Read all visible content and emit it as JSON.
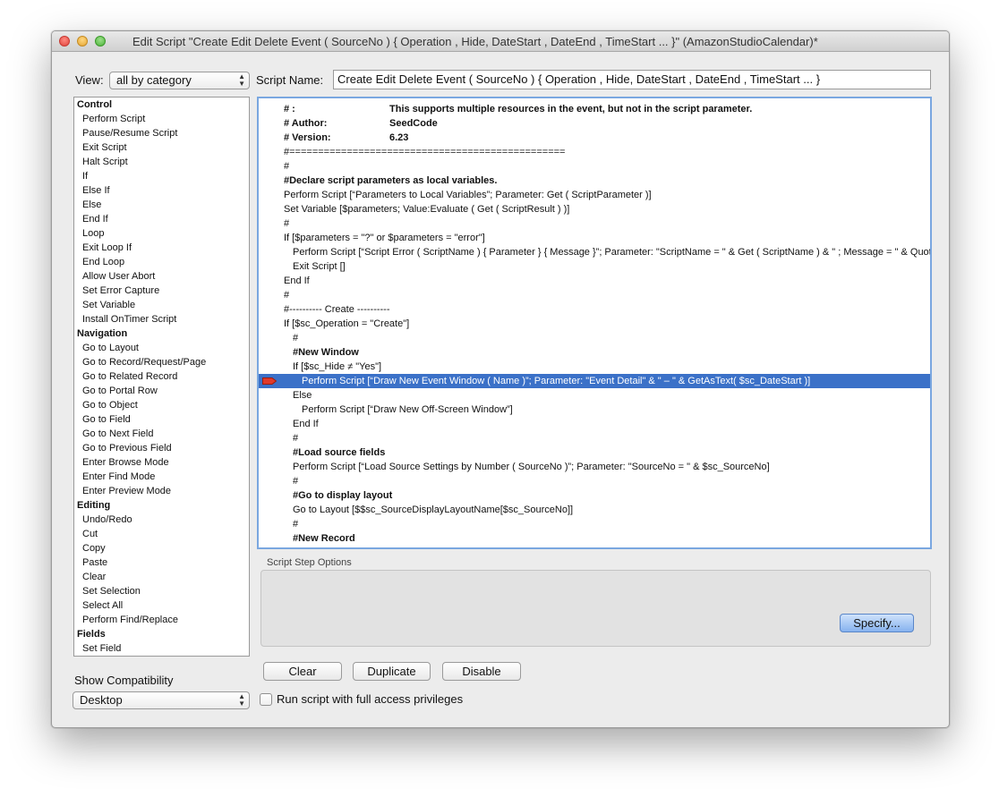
{
  "window": {
    "title": "Edit Script \"Create Edit Delete Event ( SourceNo ) { Operation , Hide, DateStart , DateEnd , TimeStart ... }\" (AmazonStudioCalendar)*"
  },
  "view": {
    "label": "View:",
    "value": "all by category"
  },
  "script_name": {
    "label": "Script Name:",
    "value": "Create Edit Delete Event ( SourceNo ) { Operation , Hide, DateStart , DateEnd , TimeStart ... }"
  },
  "steps": [
    {
      "type": "cat",
      "label": "Control"
    },
    {
      "type": "item",
      "label": "Perform Script"
    },
    {
      "type": "item",
      "label": "Pause/Resume Script"
    },
    {
      "type": "item",
      "label": "Exit Script"
    },
    {
      "type": "item",
      "label": "Halt Script"
    },
    {
      "type": "item",
      "label": "If"
    },
    {
      "type": "item",
      "label": "Else If"
    },
    {
      "type": "item",
      "label": "Else"
    },
    {
      "type": "item",
      "label": "End If"
    },
    {
      "type": "item",
      "label": "Loop"
    },
    {
      "type": "item",
      "label": "Exit Loop If"
    },
    {
      "type": "item",
      "label": "End Loop"
    },
    {
      "type": "item",
      "label": "Allow User Abort"
    },
    {
      "type": "item",
      "label": "Set Error Capture"
    },
    {
      "type": "item",
      "label": "Set Variable"
    },
    {
      "type": "item",
      "label": "Install OnTimer Script"
    },
    {
      "type": "cat",
      "label": "Navigation"
    },
    {
      "type": "item",
      "label": "Go to Layout"
    },
    {
      "type": "item",
      "label": "Go to Record/Request/Page"
    },
    {
      "type": "item",
      "label": "Go to Related Record"
    },
    {
      "type": "item",
      "label": "Go to Portal Row"
    },
    {
      "type": "item",
      "label": "Go to Object"
    },
    {
      "type": "item",
      "label": "Go to Field"
    },
    {
      "type": "item",
      "label": "Go to Next Field"
    },
    {
      "type": "item",
      "label": "Go to Previous Field"
    },
    {
      "type": "item",
      "label": "Enter Browse Mode"
    },
    {
      "type": "item",
      "label": "Enter Find Mode"
    },
    {
      "type": "item",
      "label": "Enter Preview Mode"
    },
    {
      "type": "cat",
      "label": "Editing"
    },
    {
      "type": "item",
      "label": "Undo/Redo"
    },
    {
      "type": "item",
      "label": "Cut"
    },
    {
      "type": "item",
      "label": "Copy"
    },
    {
      "type": "item",
      "label": "Paste"
    },
    {
      "type": "item",
      "label": "Clear"
    },
    {
      "type": "item",
      "label": "Set Selection"
    },
    {
      "type": "item",
      "label": "Select All"
    },
    {
      "type": "item",
      "label": "Perform Find/Replace"
    },
    {
      "type": "cat",
      "label": "Fields"
    },
    {
      "type": "item",
      "label": "Set Field"
    }
  ],
  "script_lines": [
    {
      "indent": 0,
      "bold": true,
      "text": "#  :",
      "col2": "This supports multiple resources in the event, but not in the script parameter."
    },
    {
      "indent": 0,
      "bold": true,
      "text": "#   Author:",
      "col2": "SeedCode"
    },
    {
      "indent": 0,
      "bold": true,
      "text": "#   Version:",
      "col2": "6.23"
    },
    {
      "indent": 0,
      "bold": false,
      "text": "#================================================"
    },
    {
      "indent": 0,
      "bold": false,
      "text": "#"
    },
    {
      "indent": 0,
      "bold": true,
      "text": "#Declare script parameters as local variables."
    },
    {
      "indent": 0,
      "bold": false,
      "text": "Perform Script [“Parameters to Local Variables”; Parameter: Get ( ScriptParameter )]"
    },
    {
      "indent": 0,
      "bold": false,
      "text": "Set Variable [$parameters; Value:Evaluate ( Get ( ScriptResult ) )]"
    },
    {
      "indent": 0,
      "bold": false,
      "text": "#"
    },
    {
      "indent": 0,
      "bold": false,
      "text": "If [$parameters = \"?\" or $parameters = \"error\"]"
    },
    {
      "indent": 1,
      "bold": false,
      "text": "Perform Script [“Script Error ( ScriptName ) { Parameter } { Message }”; Parameter: \"ScriptName = \" & Get ( ScriptName ) & \" ; Message = \" & Quote ( \"Missing Parameter\" )]"
    },
    {
      "indent": 1,
      "bold": false,
      "text": "Exit Script []"
    },
    {
      "indent": 0,
      "bold": false,
      "text": "End If"
    },
    {
      "indent": 0,
      "bold": false,
      "text": "#"
    },
    {
      "indent": 0,
      "bold": false,
      "text": "#---------- Create ----------"
    },
    {
      "indent": 0,
      "bold": false,
      "text": "If [$sc_Operation = \"Create\"]"
    },
    {
      "indent": 1,
      "bold": false,
      "text": "#"
    },
    {
      "indent": 1,
      "bold": true,
      "text": "#New Window"
    },
    {
      "indent": 1,
      "bold": false,
      "text": "If [$sc_Hide ≠ \"Yes\"]"
    },
    {
      "indent": 2,
      "bold": false,
      "text": "Perform Script [“Draw New Event Window ( Name )”; Parameter: \"Event Detail\" & \"  –  \" & GetAsText( $sc_DateStart )]",
      "selected": true,
      "breakpoint": true
    },
    {
      "indent": 1,
      "bold": false,
      "text": "Else"
    },
    {
      "indent": 2,
      "bold": false,
      "text": "Perform Script [“Draw New Off-Screen Window”]"
    },
    {
      "indent": 1,
      "bold": false,
      "text": "End If"
    },
    {
      "indent": 1,
      "bold": false,
      "text": "#"
    },
    {
      "indent": 1,
      "bold": true,
      "text": "#Load source fields"
    },
    {
      "indent": 1,
      "bold": false,
      "text": "Perform Script [“Load Source Settings by Number ( SourceNo )”; Parameter: \"SourceNo = \" & $sc_SourceNo]"
    },
    {
      "indent": 1,
      "bold": false,
      "text": "#"
    },
    {
      "indent": 1,
      "bold": true,
      "text": "#Go to display layout"
    },
    {
      "indent": 1,
      "bold": false,
      "text": "Go to Layout [$$sc_SourceDisplayLayoutName[$sc_SourceNo]]"
    },
    {
      "indent": 1,
      "bold": false,
      "text": "#"
    },
    {
      "indent": 1,
      "bold": true,
      "text": "#New Record"
    }
  ],
  "script_step_options": {
    "label": "Script Step Options",
    "specify_label": "Specify..."
  },
  "compatibility": {
    "label": "Show Compatibility",
    "value": "Desktop"
  },
  "buttons": {
    "clear": "Clear",
    "duplicate": "Duplicate",
    "disable": "Disable"
  },
  "full_access": {
    "label": "Run script with full access privileges",
    "checked": false
  },
  "colors": {
    "selection": "#3b71c8",
    "focus_ring": "#7aa7e0",
    "breakpoint": "#e03a2a"
  }
}
